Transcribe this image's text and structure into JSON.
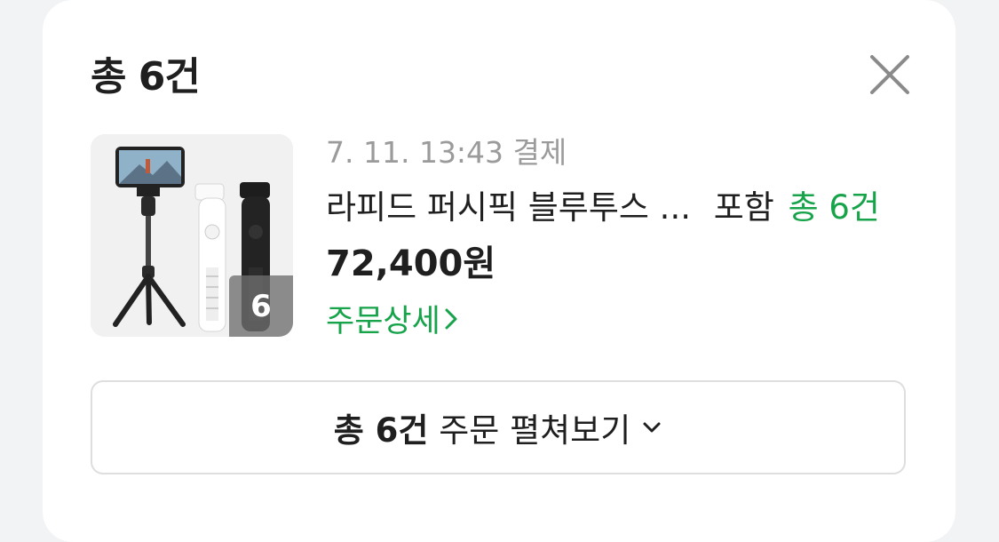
{
  "header": {
    "title": "총 6건",
    "close_icon": "close-icon"
  },
  "order": {
    "thumbnail_count": "6",
    "datetime": "7. 11. 13:43 결제",
    "product_name": "라피드 퍼시픽 블루투스 ...",
    "include_label": "포함",
    "total_count": "총 6건",
    "price": "72,400원",
    "detail_link": "주문상세",
    "detail_icon": "chevron-right-icon"
  },
  "expand_button": {
    "count_label": "총 6건",
    "label": "주문 펼쳐보기",
    "icon": "chevron-down-icon"
  },
  "colors": {
    "accent_green": "#16a34a",
    "muted_gray": "#9b9b9b",
    "text": "#1f1f1f"
  }
}
